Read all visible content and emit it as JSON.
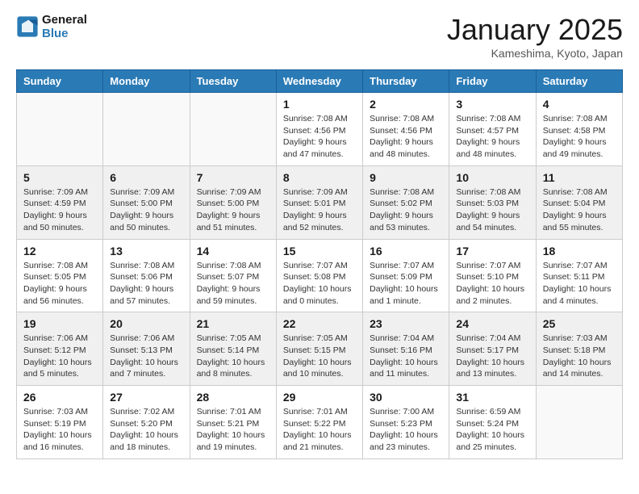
{
  "logo": {
    "line1": "General",
    "line2": "Blue"
  },
  "title": "January 2025",
  "location": "Kameshima, Kyoto, Japan",
  "weekdays": [
    "Sunday",
    "Monday",
    "Tuesday",
    "Wednesday",
    "Thursday",
    "Friday",
    "Saturday"
  ],
  "weeks": [
    [
      {
        "day": "",
        "info": ""
      },
      {
        "day": "",
        "info": ""
      },
      {
        "day": "",
        "info": ""
      },
      {
        "day": "1",
        "info": "Sunrise: 7:08 AM\nSunset: 4:56 PM\nDaylight: 9 hours and 47 minutes."
      },
      {
        "day": "2",
        "info": "Sunrise: 7:08 AM\nSunset: 4:56 PM\nDaylight: 9 hours and 48 minutes."
      },
      {
        "day": "3",
        "info": "Sunrise: 7:08 AM\nSunset: 4:57 PM\nDaylight: 9 hours and 48 minutes."
      },
      {
        "day": "4",
        "info": "Sunrise: 7:08 AM\nSunset: 4:58 PM\nDaylight: 9 hours and 49 minutes."
      }
    ],
    [
      {
        "day": "5",
        "info": "Sunrise: 7:09 AM\nSunset: 4:59 PM\nDaylight: 9 hours and 50 minutes."
      },
      {
        "day": "6",
        "info": "Sunrise: 7:09 AM\nSunset: 5:00 PM\nDaylight: 9 hours and 50 minutes."
      },
      {
        "day": "7",
        "info": "Sunrise: 7:09 AM\nSunset: 5:00 PM\nDaylight: 9 hours and 51 minutes."
      },
      {
        "day": "8",
        "info": "Sunrise: 7:09 AM\nSunset: 5:01 PM\nDaylight: 9 hours and 52 minutes."
      },
      {
        "day": "9",
        "info": "Sunrise: 7:08 AM\nSunset: 5:02 PM\nDaylight: 9 hours and 53 minutes."
      },
      {
        "day": "10",
        "info": "Sunrise: 7:08 AM\nSunset: 5:03 PM\nDaylight: 9 hours and 54 minutes."
      },
      {
        "day": "11",
        "info": "Sunrise: 7:08 AM\nSunset: 5:04 PM\nDaylight: 9 hours and 55 minutes."
      }
    ],
    [
      {
        "day": "12",
        "info": "Sunrise: 7:08 AM\nSunset: 5:05 PM\nDaylight: 9 hours and 56 minutes."
      },
      {
        "day": "13",
        "info": "Sunrise: 7:08 AM\nSunset: 5:06 PM\nDaylight: 9 hours and 57 minutes."
      },
      {
        "day": "14",
        "info": "Sunrise: 7:08 AM\nSunset: 5:07 PM\nDaylight: 9 hours and 59 minutes."
      },
      {
        "day": "15",
        "info": "Sunrise: 7:07 AM\nSunset: 5:08 PM\nDaylight: 10 hours and 0 minutes."
      },
      {
        "day": "16",
        "info": "Sunrise: 7:07 AM\nSunset: 5:09 PM\nDaylight: 10 hours and 1 minute."
      },
      {
        "day": "17",
        "info": "Sunrise: 7:07 AM\nSunset: 5:10 PM\nDaylight: 10 hours and 2 minutes."
      },
      {
        "day": "18",
        "info": "Sunrise: 7:07 AM\nSunset: 5:11 PM\nDaylight: 10 hours and 4 minutes."
      }
    ],
    [
      {
        "day": "19",
        "info": "Sunrise: 7:06 AM\nSunset: 5:12 PM\nDaylight: 10 hours and 5 minutes."
      },
      {
        "day": "20",
        "info": "Sunrise: 7:06 AM\nSunset: 5:13 PM\nDaylight: 10 hours and 7 minutes."
      },
      {
        "day": "21",
        "info": "Sunrise: 7:05 AM\nSunset: 5:14 PM\nDaylight: 10 hours and 8 minutes."
      },
      {
        "day": "22",
        "info": "Sunrise: 7:05 AM\nSunset: 5:15 PM\nDaylight: 10 hours and 10 minutes."
      },
      {
        "day": "23",
        "info": "Sunrise: 7:04 AM\nSunset: 5:16 PM\nDaylight: 10 hours and 11 minutes."
      },
      {
        "day": "24",
        "info": "Sunrise: 7:04 AM\nSunset: 5:17 PM\nDaylight: 10 hours and 13 minutes."
      },
      {
        "day": "25",
        "info": "Sunrise: 7:03 AM\nSunset: 5:18 PM\nDaylight: 10 hours and 14 minutes."
      }
    ],
    [
      {
        "day": "26",
        "info": "Sunrise: 7:03 AM\nSunset: 5:19 PM\nDaylight: 10 hours and 16 minutes."
      },
      {
        "day": "27",
        "info": "Sunrise: 7:02 AM\nSunset: 5:20 PM\nDaylight: 10 hours and 18 minutes."
      },
      {
        "day": "28",
        "info": "Sunrise: 7:01 AM\nSunset: 5:21 PM\nDaylight: 10 hours and 19 minutes."
      },
      {
        "day": "29",
        "info": "Sunrise: 7:01 AM\nSunset: 5:22 PM\nDaylight: 10 hours and 21 minutes."
      },
      {
        "day": "30",
        "info": "Sunrise: 7:00 AM\nSunset: 5:23 PM\nDaylight: 10 hours and 23 minutes."
      },
      {
        "day": "31",
        "info": "Sunrise: 6:59 AM\nSunset: 5:24 PM\nDaylight: 10 hours and 25 minutes."
      },
      {
        "day": "",
        "info": ""
      }
    ]
  ]
}
